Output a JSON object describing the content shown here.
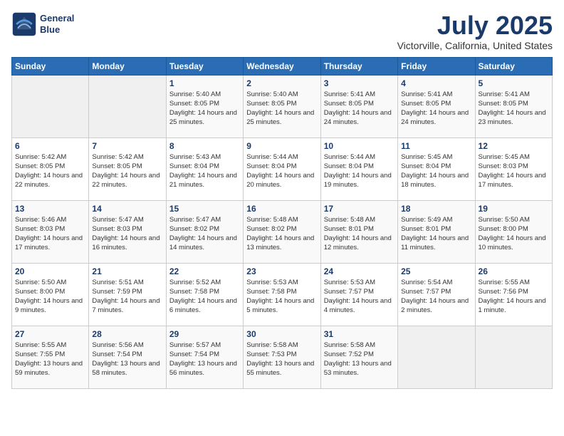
{
  "header": {
    "logo_line1": "General",
    "logo_line2": "Blue",
    "month": "July 2025",
    "location": "Victorville, California, United States"
  },
  "weekdays": [
    "Sunday",
    "Monday",
    "Tuesday",
    "Wednesday",
    "Thursday",
    "Friday",
    "Saturday"
  ],
  "weeks": [
    [
      {
        "day": "",
        "info": ""
      },
      {
        "day": "",
        "info": ""
      },
      {
        "day": "1",
        "info": "Sunrise: 5:40 AM\nSunset: 8:05 PM\nDaylight: 14 hours and 25 minutes."
      },
      {
        "day": "2",
        "info": "Sunrise: 5:40 AM\nSunset: 8:05 PM\nDaylight: 14 hours and 25 minutes."
      },
      {
        "day": "3",
        "info": "Sunrise: 5:41 AM\nSunset: 8:05 PM\nDaylight: 14 hours and 24 minutes."
      },
      {
        "day": "4",
        "info": "Sunrise: 5:41 AM\nSunset: 8:05 PM\nDaylight: 14 hours and 24 minutes."
      },
      {
        "day": "5",
        "info": "Sunrise: 5:41 AM\nSunset: 8:05 PM\nDaylight: 14 hours and 23 minutes."
      }
    ],
    [
      {
        "day": "6",
        "info": "Sunrise: 5:42 AM\nSunset: 8:05 PM\nDaylight: 14 hours and 22 minutes."
      },
      {
        "day": "7",
        "info": "Sunrise: 5:42 AM\nSunset: 8:05 PM\nDaylight: 14 hours and 22 minutes."
      },
      {
        "day": "8",
        "info": "Sunrise: 5:43 AM\nSunset: 8:04 PM\nDaylight: 14 hours and 21 minutes."
      },
      {
        "day": "9",
        "info": "Sunrise: 5:44 AM\nSunset: 8:04 PM\nDaylight: 14 hours and 20 minutes."
      },
      {
        "day": "10",
        "info": "Sunrise: 5:44 AM\nSunset: 8:04 PM\nDaylight: 14 hours and 19 minutes."
      },
      {
        "day": "11",
        "info": "Sunrise: 5:45 AM\nSunset: 8:04 PM\nDaylight: 14 hours and 18 minutes."
      },
      {
        "day": "12",
        "info": "Sunrise: 5:45 AM\nSunset: 8:03 PM\nDaylight: 14 hours and 17 minutes."
      }
    ],
    [
      {
        "day": "13",
        "info": "Sunrise: 5:46 AM\nSunset: 8:03 PM\nDaylight: 14 hours and 17 minutes."
      },
      {
        "day": "14",
        "info": "Sunrise: 5:47 AM\nSunset: 8:03 PM\nDaylight: 14 hours and 16 minutes."
      },
      {
        "day": "15",
        "info": "Sunrise: 5:47 AM\nSunset: 8:02 PM\nDaylight: 14 hours and 14 minutes."
      },
      {
        "day": "16",
        "info": "Sunrise: 5:48 AM\nSunset: 8:02 PM\nDaylight: 14 hours and 13 minutes."
      },
      {
        "day": "17",
        "info": "Sunrise: 5:48 AM\nSunset: 8:01 PM\nDaylight: 14 hours and 12 minutes."
      },
      {
        "day": "18",
        "info": "Sunrise: 5:49 AM\nSunset: 8:01 PM\nDaylight: 14 hours and 11 minutes."
      },
      {
        "day": "19",
        "info": "Sunrise: 5:50 AM\nSunset: 8:00 PM\nDaylight: 14 hours and 10 minutes."
      }
    ],
    [
      {
        "day": "20",
        "info": "Sunrise: 5:50 AM\nSunset: 8:00 PM\nDaylight: 14 hours and 9 minutes."
      },
      {
        "day": "21",
        "info": "Sunrise: 5:51 AM\nSunset: 7:59 PM\nDaylight: 14 hours and 7 minutes."
      },
      {
        "day": "22",
        "info": "Sunrise: 5:52 AM\nSunset: 7:58 PM\nDaylight: 14 hours and 6 minutes."
      },
      {
        "day": "23",
        "info": "Sunrise: 5:53 AM\nSunset: 7:58 PM\nDaylight: 14 hours and 5 minutes."
      },
      {
        "day": "24",
        "info": "Sunrise: 5:53 AM\nSunset: 7:57 PM\nDaylight: 14 hours and 4 minutes."
      },
      {
        "day": "25",
        "info": "Sunrise: 5:54 AM\nSunset: 7:57 PM\nDaylight: 14 hours and 2 minutes."
      },
      {
        "day": "26",
        "info": "Sunrise: 5:55 AM\nSunset: 7:56 PM\nDaylight: 14 hours and 1 minute."
      }
    ],
    [
      {
        "day": "27",
        "info": "Sunrise: 5:55 AM\nSunset: 7:55 PM\nDaylight: 13 hours and 59 minutes."
      },
      {
        "day": "28",
        "info": "Sunrise: 5:56 AM\nSunset: 7:54 PM\nDaylight: 13 hours and 58 minutes."
      },
      {
        "day": "29",
        "info": "Sunrise: 5:57 AM\nSunset: 7:54 PM\nDaylight: 13 hours and 56 minutes."
      },
      {
        "day": "30",
        "info": "Sunrise: 5:58 AM\nSunset: 7:53 PM\nDaylight: 13 hours and 55 minutes."
      },
      {
        "day": "31",
        "info": "Sunrise: 5:58 AM\nSunset: 7:52 PM\nDaylight: 13 hours and 53 minutes."
      },
      {
        "day": "",
        "info": ""
      },
      {
        "day": "",
        "info": ""
      }
    ]
  ]
}
